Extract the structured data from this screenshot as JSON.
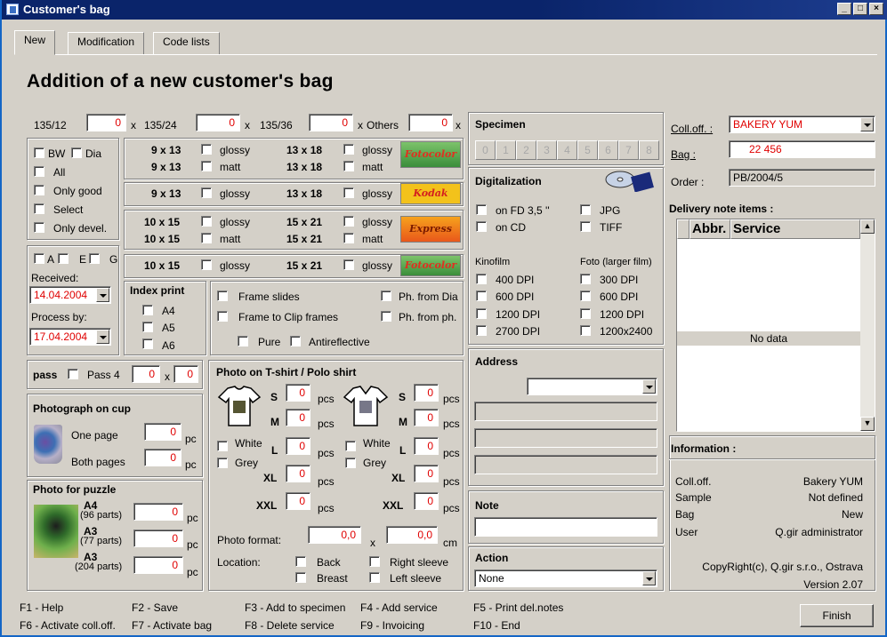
{
  "window": {
    "title": "Customer's bag",
    "min": "_",
    "max": "□",
    "close": "×"
  },
  "tabs": [
    "New",
    "Modification",
    "Code lists"
  ],
  "heading": "Addition of a new customer's bag",
  "film": {
    "f1": "135/12",
    "f2": "135/24",
    "f3": "135/36",
    "f4": "Others",
    "x": "x",
    "v1": "0",
    "v2": "0",
    "v3": "0",
    "v4": "0"
  },
  "develop": {
    "bw": "BW",
    "dia": "Dia",
    "all": "All",
    "only_good": "Only good",
    "select": "Select",
    "only_devel": "Only devel."
  },
  "sizes": {
    "r1a": "9 x 13",
    "r1b": "9 x 13",
    "r1c": "13 x 18",
    "r1d": "13 x 18",
    "r2a": "9 x 13",
    "r2c": "13 x 18",
    "r3a": "10 x 15",
    "r3b": "10 x 15",
    "r3c": "15 x 21",
    "r3d": "15 x 21",
    "r4a": "10 x 15",
    "r4c": "15 x 21",
    "glossy": "glossy",
    "matt": "matt"
  },
  "logos": {
    "l1": "Fotocolor",
    "l2": "Kodak",
    "l3": "Express",
    "l4": "Fotocolor"
  },
  "afg": {
    "a": "A",
    "e": "E",
    "g": "G"
  },
  "received": {
    "label": "Received:",
    "value": "14.04.2004"
  },
  "process": {
    "label": "Process by:",
    "value": "17.04.2004"
  },
  "index": {
    "title": "Index print",
    "a4": "A4",
    "a5": "A5",
    "a6": "A6"
  },
  "frames": {
    "frame_slides": "Frame slides",
    "frame_clip": "Frame to Clip frames",
    "ph_dia": "Ph. from Dia",
    "ph_ph": "Ph. from ph.",
    "pure": "Pure",
    "anti": "Antireflective"
  },
  "pass": {
    "label": "pass",
    "pass4": "Pass 4",
    "v1": "0",
    "x": "x",
    "v2": "0"
  },
  "cup": {
    "title": "Photograph on cup",
    "one": "One page",
    "both": "Both pages",
    "v1": "0",
    "v2": "0",
    "unit": "pc"
  },
  "puzzle": {
    "title": "Photo for puzzle",
    "a4": "A4",
    "a4p": "(96 parts)",
    "a3": "A3",
    "a3p": "(77 parts)",
    "a3b": "A3",
    "a3bp": "(204 parts)",
    "v1": "0",
    "v2": "0",
    "v3": "0",
    "unit": "pc"
  },
  "tshirt": {
    "title": "Photo on T-shirt / Polo shirt",
    "s": "S",
    "m": "M",
    "l": "L",
    "xl": "XL",
    "xxl": "XXL",
    "pcs": "pcs",
    "white": "White",
    "grey": "Grey",
    "v": "0",
    "format": "Photo format:",
    "f1": "0,0",
    "fx": "x",
    "f2": "0,0",
    "cm": "cm",
    "location": "Location:",
    "back": "Back",
    "breast": "Breast",
    "right": "Right sleeve",
    "left": "Left sleeve"
  },
  "specimen": {
    "title": "Specimen",
    "nums": [
      "0",
      "1",
      "2",
      "3",
      "4",
      "5",
      "6",
      "7",
      "8"
    ]
  },
  "digital": {
    "title": "Digitalization",
    "fd": "on FD 3,5 ''",
    "cd": "on CD",
    "jpg": "JPG",
    "tiff": "TIFF",
    "kino": "Kinofilm",
    "foto": "Foto (larger film)",
    "k": [
      "400 DPI",
      "600 DPI",
      "1200 DPI",
      "2700 DPI"
    ],
    "f": [
      "300 DPI",
      "600 DPI",
      "1200 DPI",
      "1200x2400"
    ]
  },
  "address": {
    "title": "Address"
  },
  "note": {
    "title": "Note"
  },
  "action": {
    "title": "Action",
    "value": "None"
  },
  "right": {
    "coll_label": "Coll.off. :",
    "coll_value": "BAKERY YUM",
    "bag_label": "Bag :",
    "bag_value": "22 456",
    "order_label": "Order :",
    "order_value": "PB/2004/5"
  },
  "delivery": {
    "title": "Delivery note items :",
    "abbr": "Abbr.",
    "service": "Service",
    "nodata": "No data"
  },
  "info": {
    "title": "Information :",
    "k1": "Coll.off.",
    "v1": "Bakery  YUM",
    "k2": "Sample",
    "v2": "Not defined",
    "k3": "Bag",
    "v3": "New",
    "k4": "User",
    "v4": "Q.gir administrator",
    "copy": "CopyRight(c), Q.gir s.r.o., Ostrava",
    "version": "Version 2.07"
  },
  "fkeys": {
    "f1": "F1  - Help",
    "f2": "F2  - Save",
    "f3": "F3  - Add to specimen",
    "f4": "F4  - Add service",
    "f5": "F5    - Print del.notes",
    "f6": "F6  - Activate coll.off.",
    "f7": "F7  - Activate bag",
    "f8": "F8  - Delete service",
    "f9": "F9  - Invoicing",
    "f10": "F10  - End"
  },
  "finish": "Finish"
}
